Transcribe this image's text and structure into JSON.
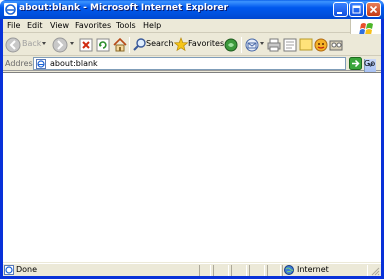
{
  "window": {
    "title": "about:blank - Microsoft Internet Explorer",
    "accent_color": "#0054e3"
  },
  "menubar": {
    "items": [
      {
        "label": "File"
      },
      {
        "label": "Edit"
      },
      {
        "label": "View"
      },
      {
        "label": "Favorites"
      },
      {
        "label": "Tools"
      },
      {
        "label": "Help"
      }
    ]
  },
  "toolbar": {
    "back_label": "Back",
    "search_label": "Search",
    "favorites_label": "Favorites",
    "icons": [
      "back-icon",
      "forward-icon",
      "stop-icon",
      "refresh-icon",
      "home-icon",
      "search-icon",
      "favorites-icon",
      "media-icon",
      "mail-icon",
      "print-icon",
      "edit-icon",
      "discuss-icon",
      "messenger-icon",
      "research-icon"
    ]
  },
  "addressbar": {
    "label": "Address",
    "value": "about:blank",
    "go_label": "Go"
  },
  "statusbar": {
    "status": "Done",
    "zone": "Internet"
  }
}
